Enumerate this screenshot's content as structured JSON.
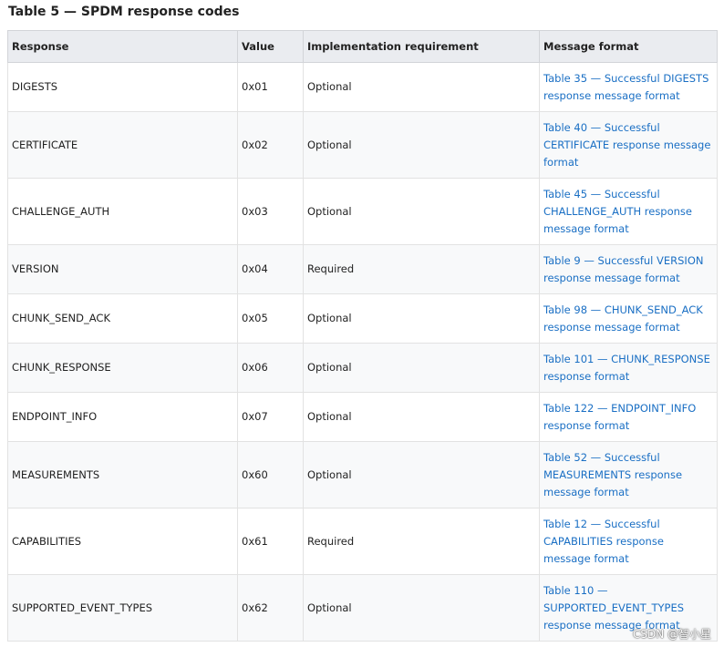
{
  "caption": "Table 5 — SPDM response codes",
  "headers": {
    "response": "Response",
    "value": "Value",
    "requirement": "Implementation requirement",
    "format": "Message format"
  },
  "rows": [
    {
      "response": "DIGESTS",
      "value": "0x01",
      "requirement": "Optional",
      "format": "Table 35 — Successful DIGESTS response message format"
    },
    {
      "response": "CERTIFICATE",
      "value": "0x02",
      "requirement": "Optional",
      "format": "Table 40 — Successful CERTIFICATE response message format"
    },
    {
      "response": "CHALLENGE_AUTH",
      "value": "0x03",
      "requirement": "Optional",
      "format": "Table 45 — Successful CHALLENGE_AUTH response message format"
    },
    {
      "response": "VERSION",
      "value": "0x04",
      "requirement": "Required",
      "format": "Table 9 — Successful VERSION response message format"
    },
    {
      "response": "CHUNK_SEND_ACK",
      "value": "0x05",
      "requirement": "Optional",
      "format": "Table 98 — CHUNK_SEND_ACK response message format"
    },
    {
      "response": "CHUNK_RESPONSE",
      "value": "0x06",
      "requirement": "Optional",
      "format": "Table 101 — CHUNK_RESPONSE response format"
    },
    {
      "response": "ENDPOINT_INFO",
      "value": "0x07",
      "requirement": "Optional",
      "format": "Table 122 — ENDPOINT_INFO response format"
    },
    {
      "response": "MEASUREMENTS",
      "value": "0x60",
      "requirement": "Optional",
      "format": "Table 52 — Successful MEASUREMENTS response message format"
    },
    {
      "response": "CAPABILITIES",
      "value": "0x61",
      "requirement": "Required",
      "format": "Table 12 — Successful CAPABILITIES response message format"
    },
    {
      "response": "SUPPORTED_EVENT_TYPES",
      "value": "0x62",
      "requirement": "Optional",
      "format": "Table 110 — SUPPORTED_EVENT_TYPES response message format"
    }
  ],
  "watermark": "CSDN @智小星"
}
